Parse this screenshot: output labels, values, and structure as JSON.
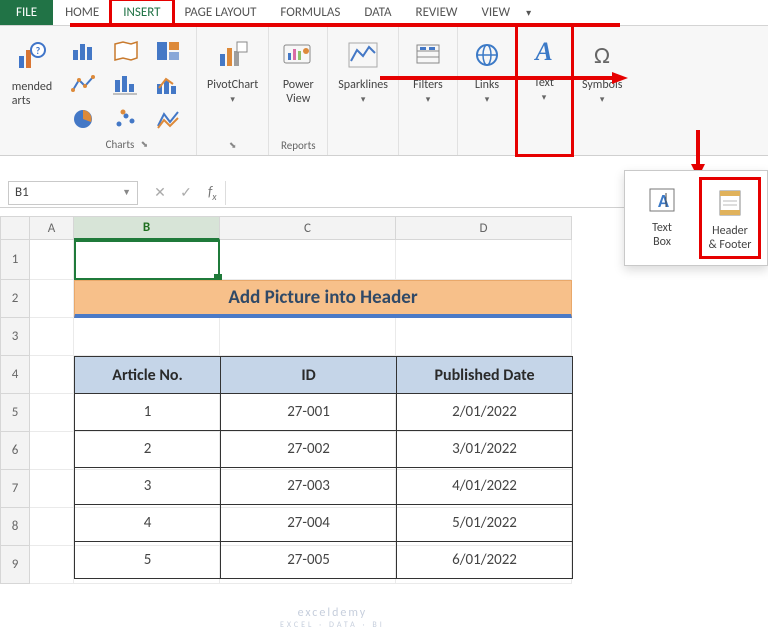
{
  "tabs": {
    "file": "FILE",
    "home": "HOME",
    "insert": "INSERT",
    "page_layout": "PAGE LAYOUT",
    "formulas": "FORMULAS",
    "data": "DATA",
    "review": "REVIEW",
    "view": "VIEW"
  },
  "ribbon": {
    "rec_charts_line1": "mended",
    "rec_charts_line2": "arts",
    "charts_label": "Charts",
    "pivotchart": "PivotChart",
    "powerview": "Power",
    "powerview2": "View",
    "reports_label": "Reports",
    "sparklines": "Sparklines",
    "filters": "Filters",
    "links": "Links",
    "text": "Text",
    "symbols": "Symbols"
  },
  "text_panel": {
    "text_box_l1": "Text",
    "text_box_l2": "Box",
    "header_l1": "Header",
    "header_l2": "& Footer"
  },
  "namebox": "B1",
  "columns": {
    "A": "A",
    "B": "B",
    "C": "C",
    "D": "D"
  },
  "rows": [
    "1",
    "2",
    "3",
    "4",
    "5",
    "6",
    "7",
    "8",
    "9"
  ],
  "title_cell": "Add Picture into Header",
  "table": {
    "headers": [
      "Article No.",
      "ID",
      "Published Date"
    ],
    "rows": [
      [
        "1",
        "27-001",
        "2/01/2022"
      ],
      [
        "2",
        "27-002",
        "3/01/2022"
      ],
      [
        "3",
        "27-003",
        "4/01/2022"
      ],
      [
        "4",
        "27-004",
        "5/01/2022"
      ],
      [
        "5",
        "27-005",
        "6/01/2022"
      ]
    ]
  },
  "watermark": {
    "main": "exceldemy",
    "sub": "EXCEL · DATA · BI"
  }
}
